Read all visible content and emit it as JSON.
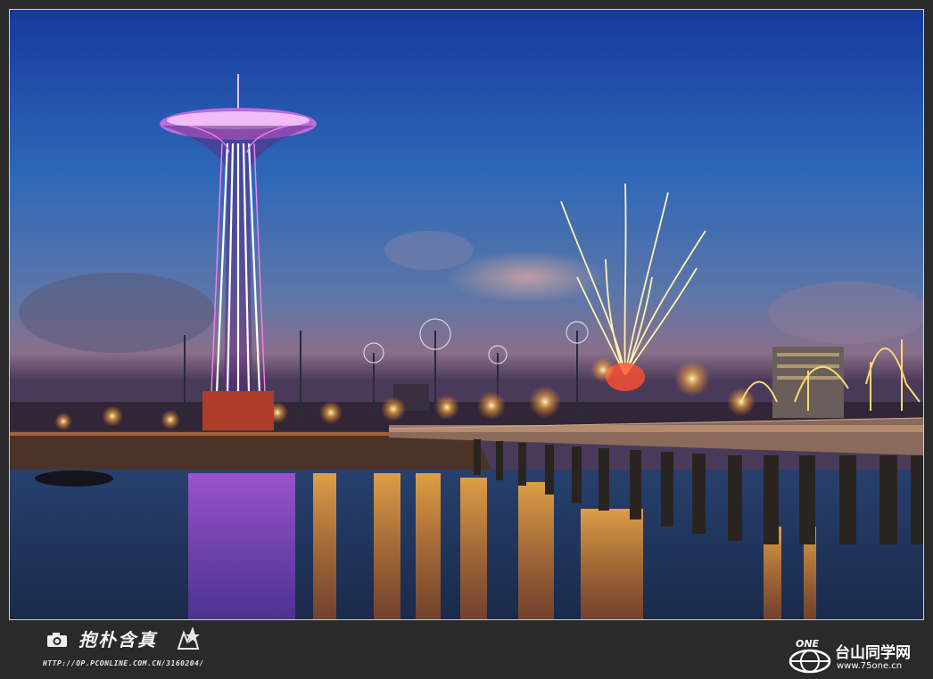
{
  "photo": {
    "scene": "night-pier-with-parachute-tower-and-fireworks",
    "colors": {
      "sky_top": "#163aa0",
      "sky_mid": "#2f63b8",
      "horizon": "#8a7fa8",
      "water": "#1c2e5a",
      "tower_glow": "#ff9cf0",
      "lights": "#ffb340"
    }
  },
  "footer": {
    "camera_icon": "camera-icon",
    "signature": "抱朴含真",
    "signature_url": "HTTP://OP.PCONLINE.COM.CN/3160204/",
    "logo_text": "ONE",
    "site_name": "台山同学网",
    "site_url": "www.75one.cn"
  }
}
